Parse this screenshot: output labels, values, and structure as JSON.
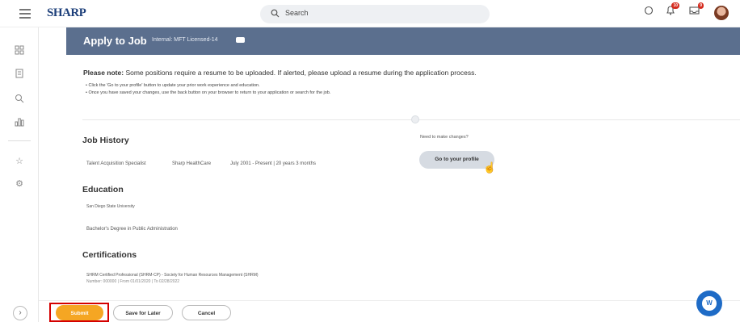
{
  "topbar": {
    "logo": "SHARP",
    "search_placeholder": "Search",
    "notifications_count": "10",
    "inbox_count": "9"
  },
  "header": {
    "title": "Apply to Job",
    "subtitle": "Internal: MFT Licensed-14"
  },
  "note": {
    "lead": "Please note:",
    "text": " Some positions require a resume to be uploaded. If alerted, please upload a resume during the application process.",
    "bullets": [
      "Click the 'Go to your profile' button to update your prior work experience and education.",
      "Once you have saved your changes, use the back button on your browser to return to your application or search for the job."
    ]
  },
  "profile_panel": {
    "label": "Need to make changes?",
    "button": "Go to your profile"
  },
  "job_history": {
    "heading": "Job History",
    "title": "Talent Acquisition Specialist",
    "company": "Sharp HealthCare",
    "dates": "July 2001 - Present | 20 years 3 months"
  },
  "education": {
    "heading": "Education",
    "school": "San Diego State University",
    "degree": "Bachelor's Degree in Public Administration"
  },
  "certifications": {
    "heading": "Certifications",
    "name": "SHRM Certified Professional (SHRM-CP) - Society for Human Resources Management (SHRM)",
    "details": "Number: 000000 | From 01/01/2020 | To 02/28/2022"
  },
  "footer": {
    "submit": "Submit",
    "save_later": "Save for Later",
    "cancel": "Cancel"
  },
  "colors": {
    "header_band": "#5b6f8e",
    "submit": "#f5a623",
    "highlight": "#d40000",
    "help": "#1e6bc6"
  }
}
